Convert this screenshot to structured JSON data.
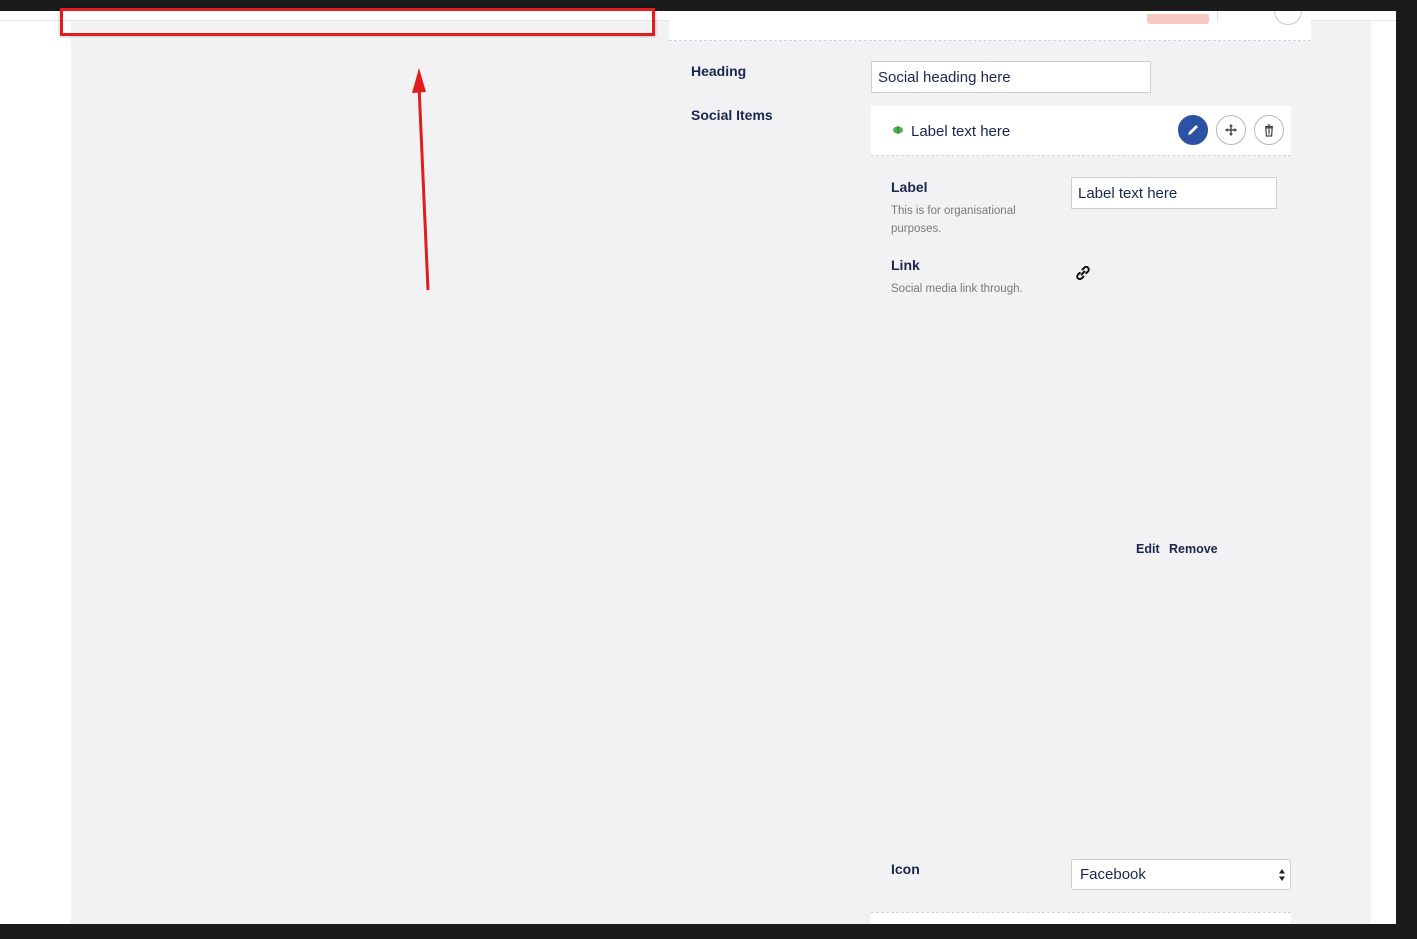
{
  "fields": {
    "heading": {
      "label": "Heading",
      "value": "Social heading here"
    },
    "social_items": {
      "label": "Social Items",
      "item_title": "Label text here",
      "label_field": {
        "label": "Label",
        "description": "This is for organisational purposes.",
        "value": "Label text here"
      },
      "link_field": {
        "label": "Link",
        "description": "Social media link through.",
        "edit_label": "Edit",
        "remove_label": "Remove"
      },
      "icon_field": {
        "label": "Icon",
        "selected": "Facebook"
      }
    }
  },
  "colors": {
    "primary_button": "#2c52a4",
    "text": "#1b264f",
    "annotation": "#e01e1e",
    "item_icon": "#4caf50"
  },
  "icons": [
    "leaf-icon",
    "pencil-icon",
    "move-icon",
    "trash-icon",
    "link-icon",
    "select-arrows-icon",
    "annotation-arrow-icon"
  ]
}
